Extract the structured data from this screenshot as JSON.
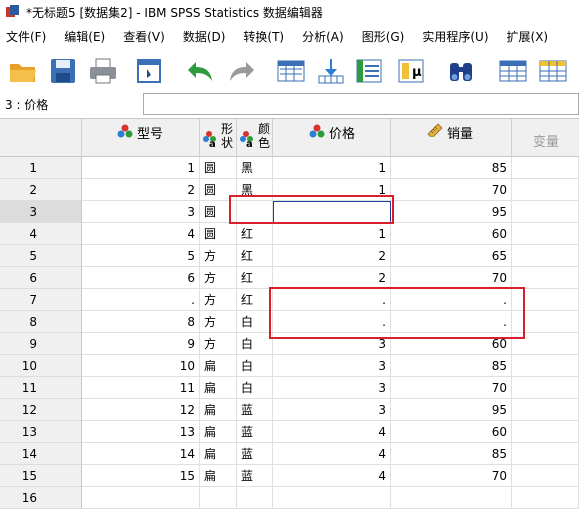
{
  "window": {
    "title": "*无标题5 [数据集2] - IBM SPSS Statistics 数据编辑器"
  },
  "menu": [
    "文件(F)",
    "编辑(E)",
    "查看(V)",
    "数据(D)",
    "转换(T)",
    "分析(A)",
    "图形(G)",
    "实用程序(U)",
    "扩展(X)"
  ],
  "toolbar": [
    "open-icon",
    "save-icon",
    "print-icon",
    "dialog-recall-icon",
    "undo-icon",
    "redo-icon",
    "goto-case-icon",
    "goto-variable-icon",
    "variables-icon",
    "statistics-icon",
    "find-icon",
    "insert-cases-icon",
    "insert-variable-icon"
  ],
  "cellbar": {
    "ref": "3 : 价格",
    "value": ""
  },
  "columns": [
    {
      "label": "型号",
      "icon": "nominal-icon"
    },
    {
      "label": "形\n状",
      "icon": "string-icon"
    },
    {
      "label": "颜\n色",
      "icon": "string-icon"
    },
    {
      "label": "价格",
      "icon": "nominal-icon"
    },
    {
      "label": "销量",
      "icon": "scale-icon"
    },
    {
      "label": "变量",
      "icon": ""
    }
  ],
  "rows": [
    [
      "1",
      "1",
      "圆",
      "黑",
      "1",
      "85"
    ],
    [
      "2",
      "2",
      "圆",
      "黑",
      "1",
      "70"
    ],
    [
      "3",
      "3",
      "圆",
      "",
      "",
      "95"
    ],
    [
      "4",
      "4",
      "圆",
      "红",
      "1",
      "60"
    ],
    [
      "5",
      "5",
      "方",
      "红",
      "2",
      "65"
    ],
    [
      "6",
      "6",
      "方",
      "红",
      "2",
      "70"
    ],
    [
      "7",
      ".",
      "方",
      "红",
      ".",
      "."
    ],
    [
      "8",
      "8",
      "方",
      "白",
      ".",
      "."
    ],
    [
      "9",
      "9",
      "方",
      "白",
      "3",
      "60"
    ],
    [
      "10",
      "10",
      "扁",
      "白",
      "3",
      "85"
    ],
    [
      "11",
      "11",
      "扁",
      "白",
      "3",
      "70"
    ],
    [
      "12",
      "12",
      "扁",
      "蓝",
      "3",
      "95"
    ],
    [
      "13",
      "13",
      "扁",
      "蓝",
      "4",
      "60"
    ],
    [
      "14",
      "14",
      "扁",
      "蓝",
      "4",
      "85"
    ],
    [
      "15",
      "15",
      "扁",
      "蓝",
      "4",
      "70"
    ],
    [
      "16",
      "",
      "",
      "",
      "",
      ""
    ]
  ],
  "colors": {
    "highlight_box": "#d9202a",
    "header_bg": "#f0f0f0",
    "active_cell_border": "#1a3f9e"
  }
}
